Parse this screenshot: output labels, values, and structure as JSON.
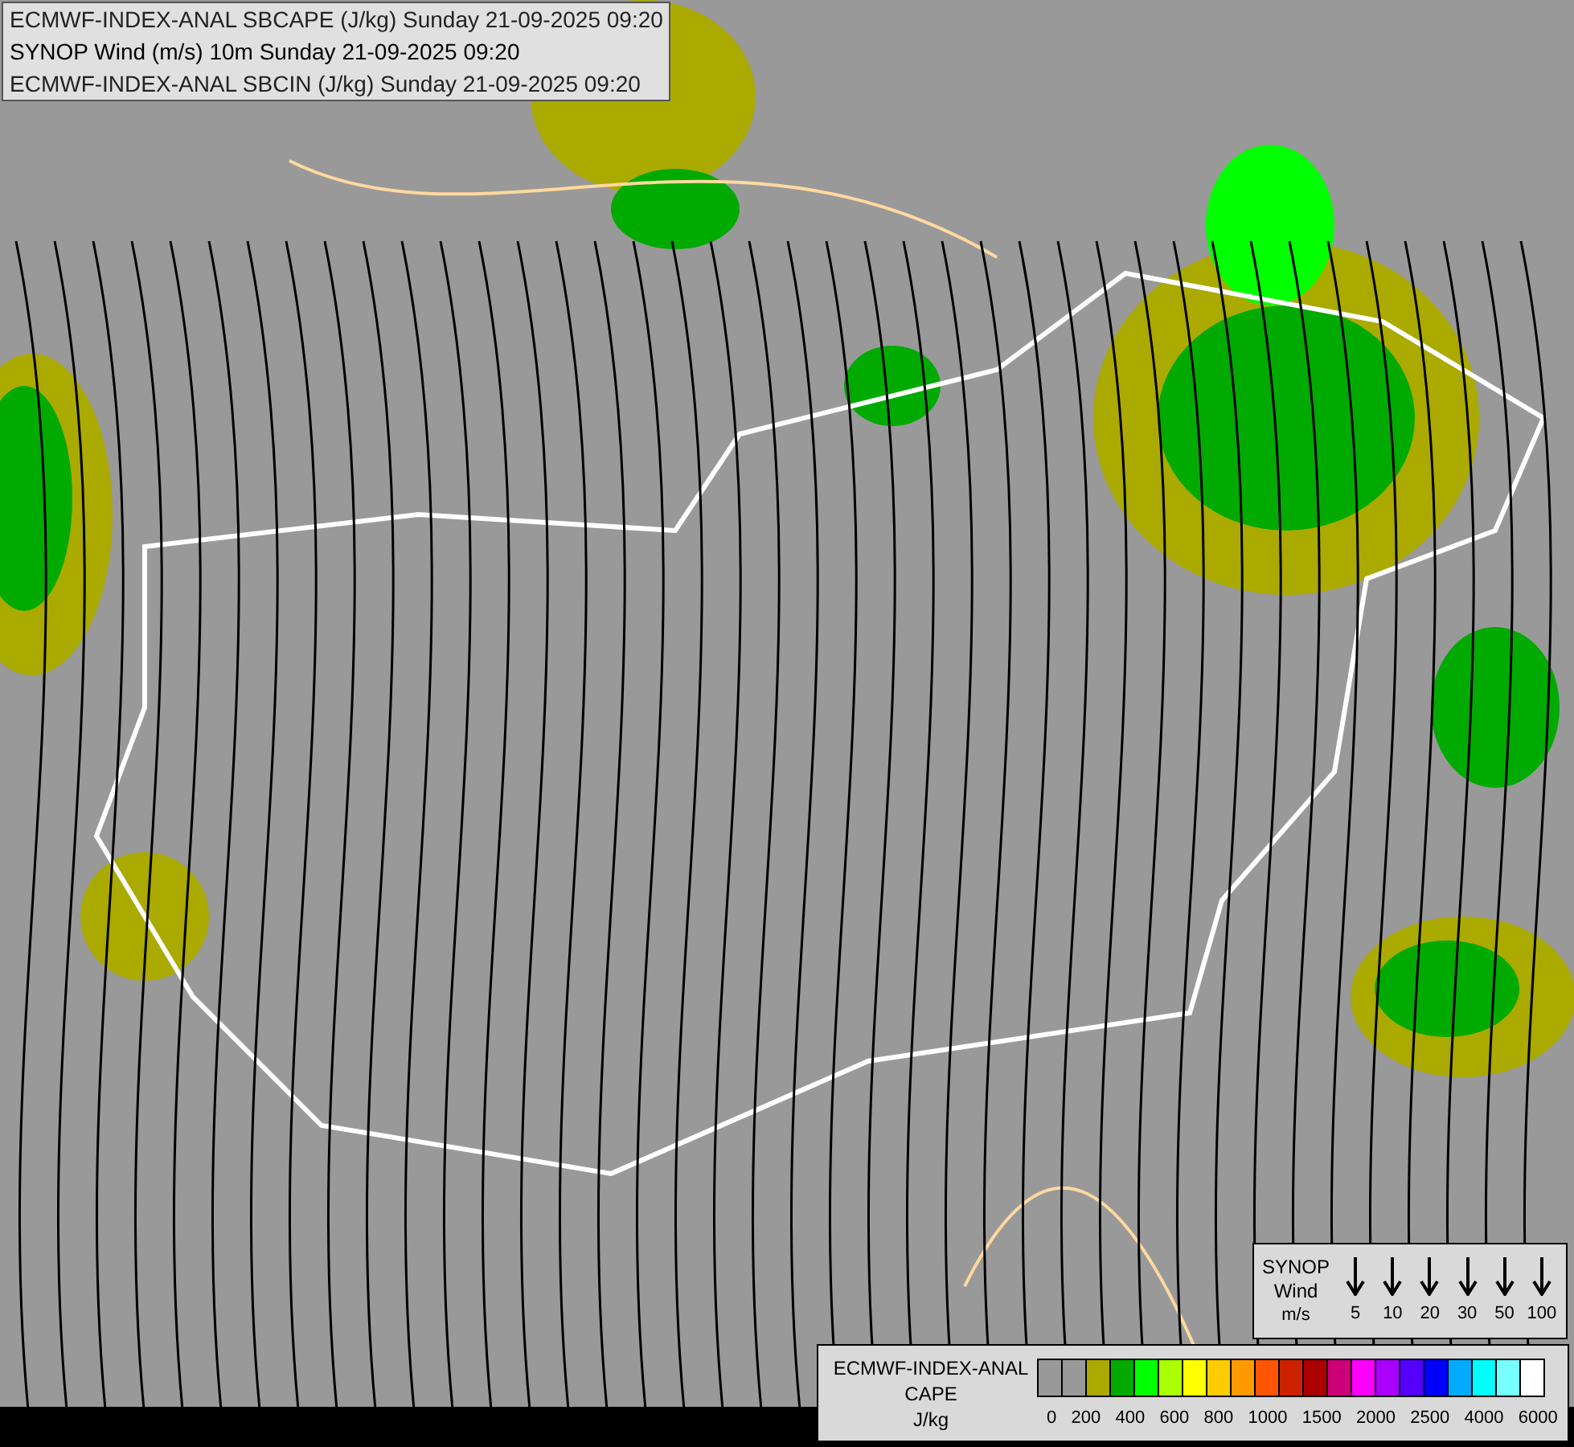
{
  "title_box": {
    "lines": [
      "ECMWF-INDEX-ANAL SBCAPE (J/kg) Sunday 21-09-2025 09:20",
      "SYNOP Wind (m/s) 10m Sunday 21-09-2025 09:20",
      "ECMWF-INDEX-ANAL SBCIN (J/kg) Sunday 21-09-2025 09:20"
    ]
  },
  "wind_legend": {
    "title": [
      "SYNOP",
      "Wind",
      "m/s"
    ],
    "speeds": [
      "5",
      "10",
      "20",
      "30",
      "50",
      "100"
    ]
  },
  "cape_legend": {
    "title": [
      "ECMWF-INDEX-ANAL",
      "CAPE",
      "J/kg"
    ],
    "swatches": [
      {
        "color": "#999999"
      },
      {
        "color": "#999999"
      },
      {
        "color": "#aaaa00"
      },
      {
        "color": "#00aa00"
      },
      {
        "color": "#00ff00"
      },
      {
        "color": "#aaff00"
      },
      {
        "color": "#ffff00"
      },
      {
        "color": "#ffcc00"
      },
      {
        "color": "#ff9900"
      },
      {
        "color": "#ff5500"
      },
      {
        "color": "#cc2200"
      },
      {
        "color": "#aa0000"
      },
      {
        "color": "#cc0077"
      },
      {
        "color": "#ff00ff"
      },
      {
        "color": "#aa00ff"
      },
      {
        "color": "#5500ff"
      },
      {
        "color": "#0000ff"
      },
      {
        "color": "#00aaff"
      },
      {
        "color": "#00ffff"
      },
      {
        "color": "#77ffff"
      },
      {
        "color": "#ffffff"
      }
    ],
    "ticks": [
      "0",
      "200",
      "400",
      "600",
      "800",
      "1000",
      "1500",
      "2000",
      "2500",
      "4000",
      "6000"
    ]
  }
}
